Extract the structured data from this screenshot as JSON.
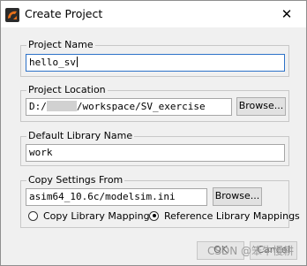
{
  "window": {
    "title": "Create Project",
    "close_icon": "close-icon",
    "app_icon": "modelsim-logo-icon"
  },
  "project_name": {
    "label": "Project Name",
    "value": "hello_sv"
  },
  "project_location": {
    "label": "Project Location",
    "value_prefix": "D:/",
    "value_suffix": "/workspace/SV_exercise",
    "browse_label": "Browse..."
  },
  "default_library": {
    "label": "Default Library Name",
    "value": "work"
  },
  "copy_settings": {
    "label": "Copy Settings From",
    "value": "asim64_10.6c/modelsim.ini",
    "browse_label": "Browse...",
    "options": [
      {
        "label": "Copy Library Mappings",
        "selected": false
      },
      {
        "label": "Reference Library Mappings",
        "selected": true
      }
    ]
  },
  "footer": {
    "ok_label": "OK",
    "cancel_label": "Cancel",
    "watermark": "CSDN @笨牛慢耕"
  }
}
